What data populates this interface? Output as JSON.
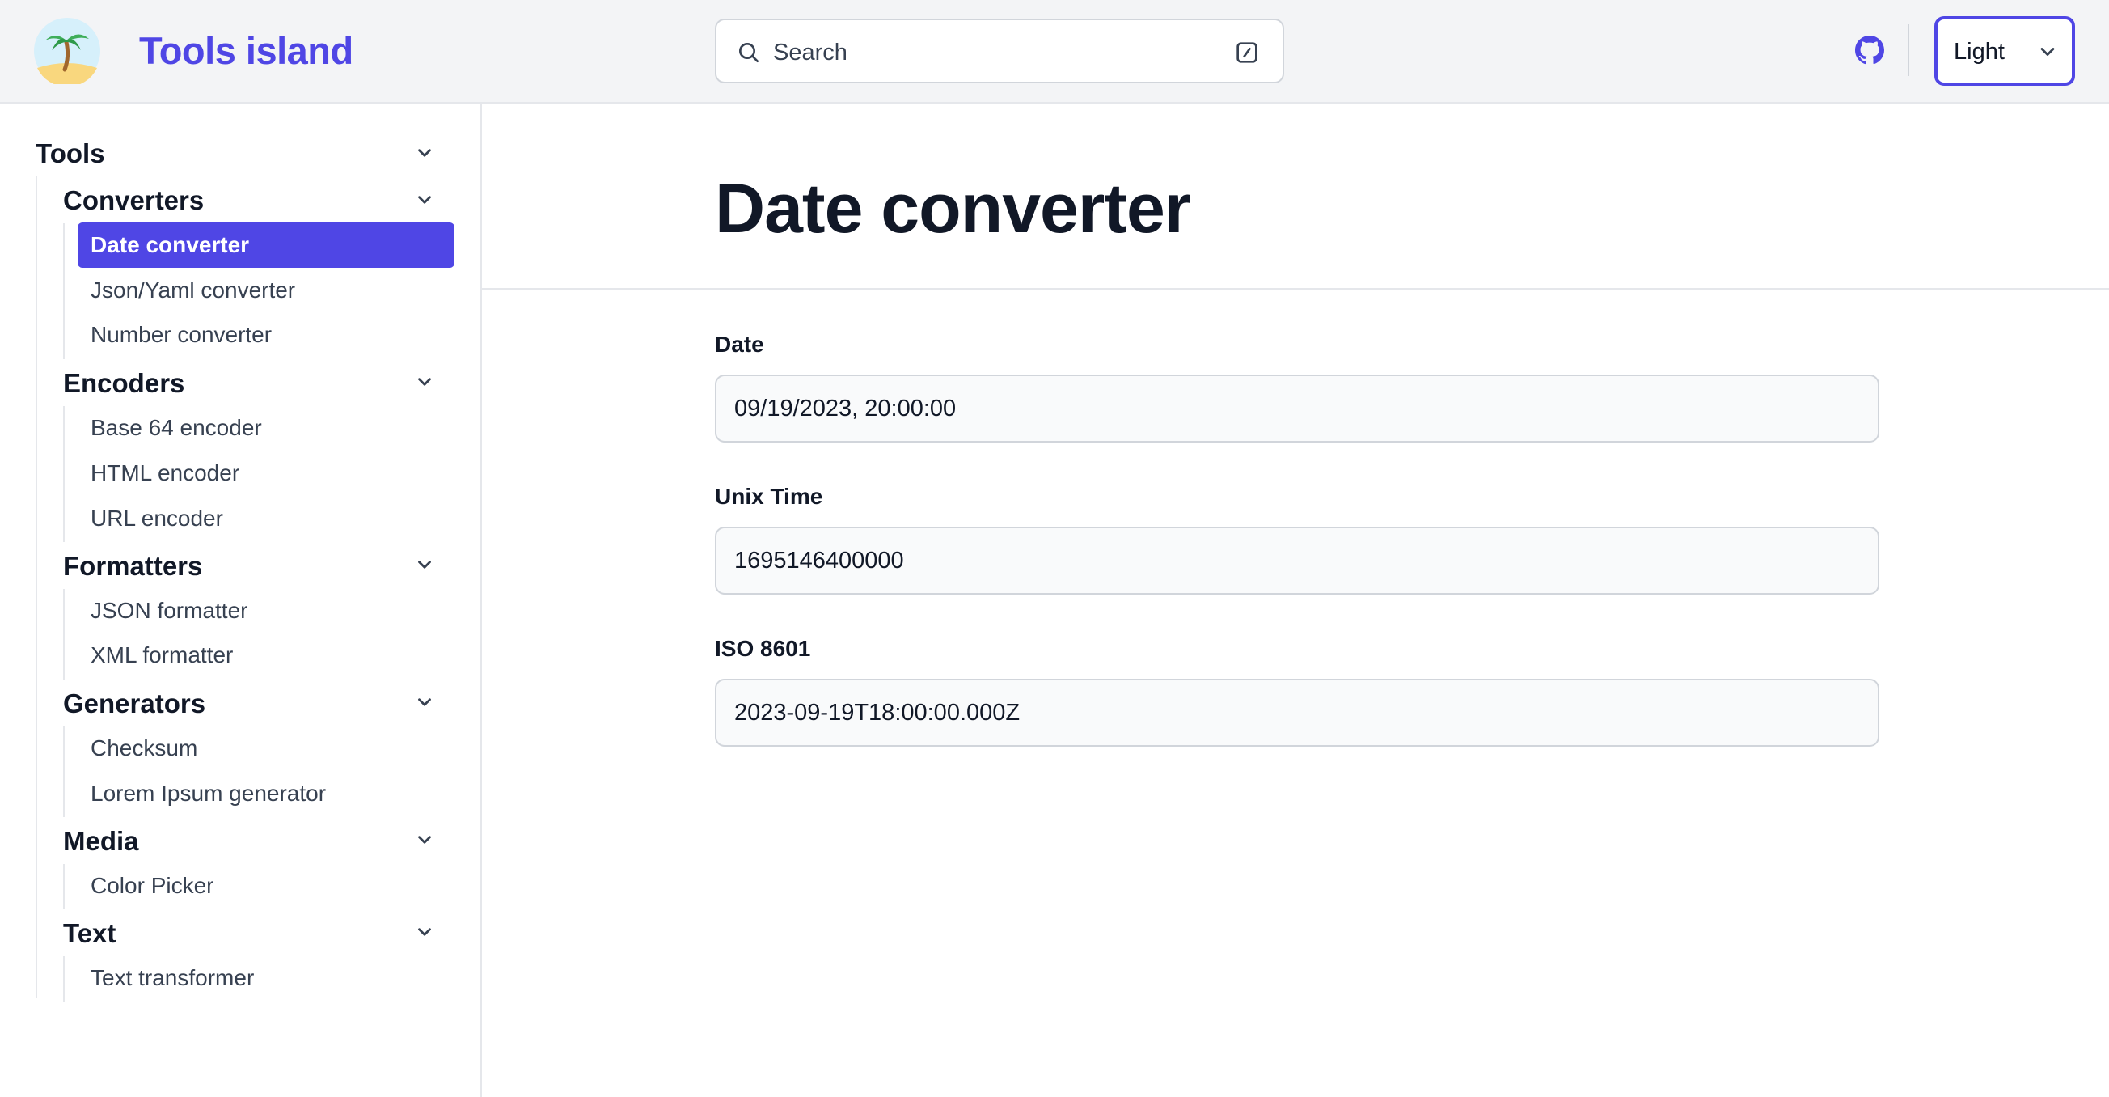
{
  "header": {
    "brand": "Tools island",
    "search_placeholder": "Search",
    "theme_value": "Light",
    "logo_icon": "palm-island-icon",
    "accent_color": "#4f46e5"
  },
  "sidebar": {
    "root_title": "Tools",
    "groups": [
      {
        "title": "Converters",
        "items": [
          "Date converter",
          "Json/Yaml converter",
          "Number converter"
        ]
      },
      {
        "title": "Encoders",
        "items": [
          "Base 64 encoder",
          "HTML encoder",
          "URL encoder"
        ]
      },
      {
        "title": "Formatters",
        "items": [
          "JSON formatter",
          "XML formatter"
        ]
      },
      {
        "title": "Generators",
        "items": [
          "Checksum",
          "Lorem Ipsum generator"
        ]
      },
      {
        "title": "Media",
        "items": [
          "Color Picker"
        ]
      },
      {
        "title": "Text",
        "items": [
          "Text transformer"
        ]
      }
    ],
    "active_item": "Date converter"
  },
  "main": {
    "title": "Date converter",
    "fields": [
      {
        "label": "Date",
        "value": "09/19/2023, 20:00:00"
      },
      {
        "label": "Unix Time",
        "value": "1695146400000"
      },
      {
        "label": "ISO 8601",
        "value": "2023-09-19T18:00:00.000Z"
      }
    ]
  }
}
